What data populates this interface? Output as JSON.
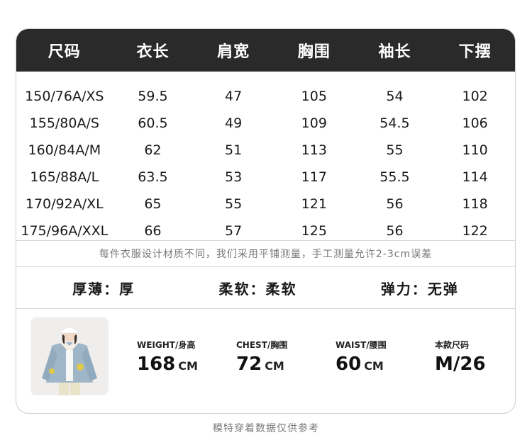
{
  "table": {
    "headers": [
      "尺码",
      "衣长",
      "肩宽",
      "胸围",
      "袖长",
      "下摆"
    ],
    "rows": [
      [
        "150/76A/XS",
        "59.5",
        "47",
        "105",
        "54",
        "102"
      ],
      [
        "155/80A/S",
        "60.5",
        "49",
        "109",
        "54.5",
        "106"
      ],
      [
        "160/84A/M",
        "62",
        "51",
        "113",
        "55",
        "110"
      ],
      [
        "165/88A/L",
        "63.5",
        "53",
        "117",
        "55.5",
        "114"
      ],
      [
        "170/92A/XL",
        "65",
        "55",
        "121",
        "56",
        "118"
      ],
      [
        "175/96A/XXL",
        "66",
        "57",
        "125",
        "56",
        "122"
      ]
    ]
  },
  "note": "每件衣服设计材质不同，我们采用平铺测量，手工测量允许2-3cm误差",
  "attributes": [
    {
      "label": "厚薄：",
      "value": "厚"
    },
    {
      "label": "柔软：",
      "value": "柔软"
    },
    {
      "label": "弹力：",
      "value": "无弹"
    }
  ],
  "model": {
    "stats": [
      {
        "label": "WEIGHT/身高",
        "value": "168",
        "unit": "CM"
      },
      {
        "label": "CHEST/胸围",
        "value": "72",
        "unit": "CM"
      },
      {
        "label": "WAIST/腰围",
        "value": "60",
        "unit": "CM"
      },
      {
        "label": "本款尺码",
        "value": "M/26",
        "unit": ""
      }
    ]
  },
  "footer": "模特穿着数据仅供参考",
  "colors": {
    "header_bg": "#2a2a2a",
    "header_text": "#ffffff",
    "border": "#cfcfcf"
  }
}
